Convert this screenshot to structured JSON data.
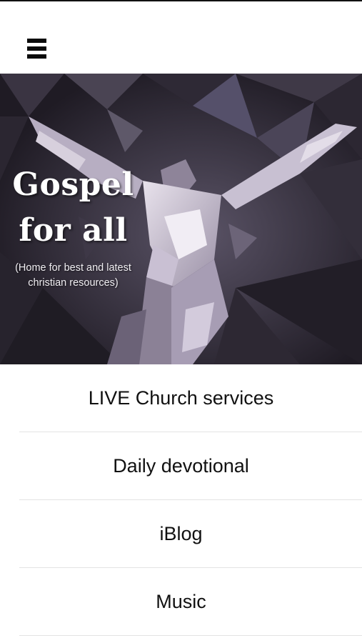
{
  "header": {
    "menu_icon": "hamburger-icon"
  },
  "hero": {
    "title_line1": "Gospel",
    "title_line2": "for all",
    "tagline_line1": "(Home for best and latest",
    "tagline_line2": "christian resources)"
  },
  "menu": {
    "items": [
      {
        "label": "LIVE Church services"
      },
      {
        "label": "Daily devotional"
      },
      {
        "label": "iBlog"
      },
      {
        "label": "Music"
      }
    ]
  },
  "colors": {
    "hero_background": "#2a2530",
    "accent_light": "#d8d0de",
    "text": "#111111",
    "divider": "#e3e3e3"
  }
}
